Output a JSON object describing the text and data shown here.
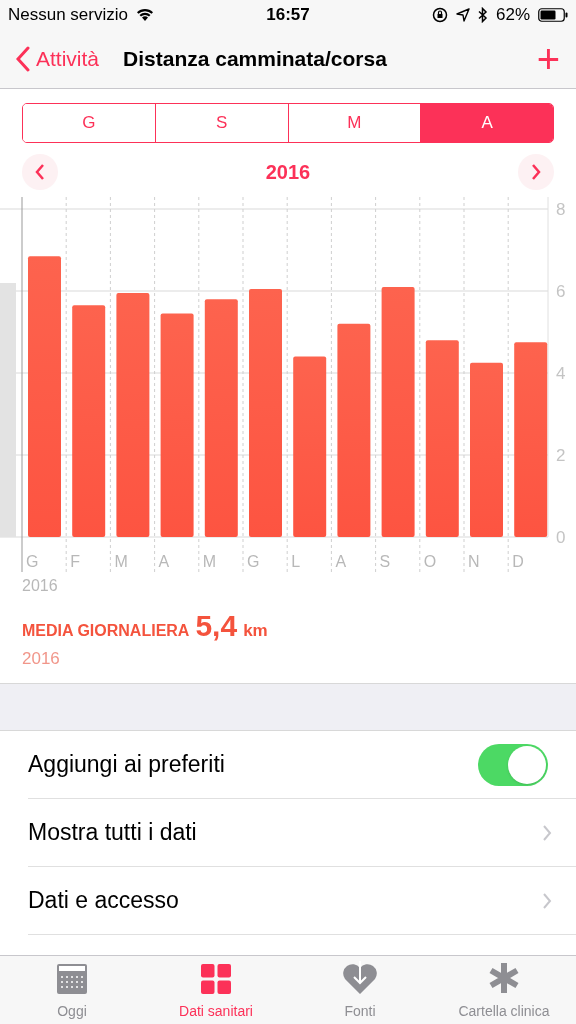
{
  "status_bar": {
    "carrier": "Nessun servizio",
    "time": "16:57",
    "battery": "62%"
  },
  "nav": {
    "back": "Attività",
    "title": "Distanza camminata/corsa",
    "add": "+"
  },
  "segments": [
    {
      "label": "G",
      "selected": false
    },
    {
      "label": "S",
      "selected": false
    },
    {
      "label": "M",
      "selected": false
    },
    {
      "label": "A",
      "selected": true
    }
  ],
  "period": {
    "label": "2016"
  },
  "chart": {
    "year_label": "2016",
    "chart_data": {
      "type": "bar",
      "categories": [
        "G",
        "F",
        "M",
        "A",
        "M",
        "G",
        "L",
        "A",
        "S",
        "O",
        "N",
        "D"
      ],
      "series": [
        {
          "color": "#fd5441",
          "values": [
            6.85,
            5.65,
            5.95,
            5.45,
            5.8,
            6.05,
            4.4,
            5.2,
            6.1,
            4.8,
            4.25,
            4.75
          ]
        }
      ],
      "ylim": [
        0,
        8
      ],
      "yticks": [
        0,
        2,
        4,
        6,
        8
      ],
      "grid": true
    }
  },
  "summary": {
    "label": "MEDIA GIORNALIERA",
    "value": "5,4",
    "unit": "km",
    "period": "2016"
  },
  "rows": [
    {
      "kind": "toggle",
      "label": "Aggiungi ai preferiti",
      "on": true
    },
    {
      "kind": "link",
      "label": "Mostra tutti i dati"
    },
    {
      "kind": "link",
      "label": "Dati e accesso"
    }
  ],
  "tab_bar": [
    {
      "label": "Oggi",
      "selected": false
    },
    {
      "label": "Dati sanitari",
      "selected": true
    },
    {
      "label": "Fonti",
      "selected": false
    },
    {
      "label": "Cartella clinica",
      "selected": false
    }
  ]
}
